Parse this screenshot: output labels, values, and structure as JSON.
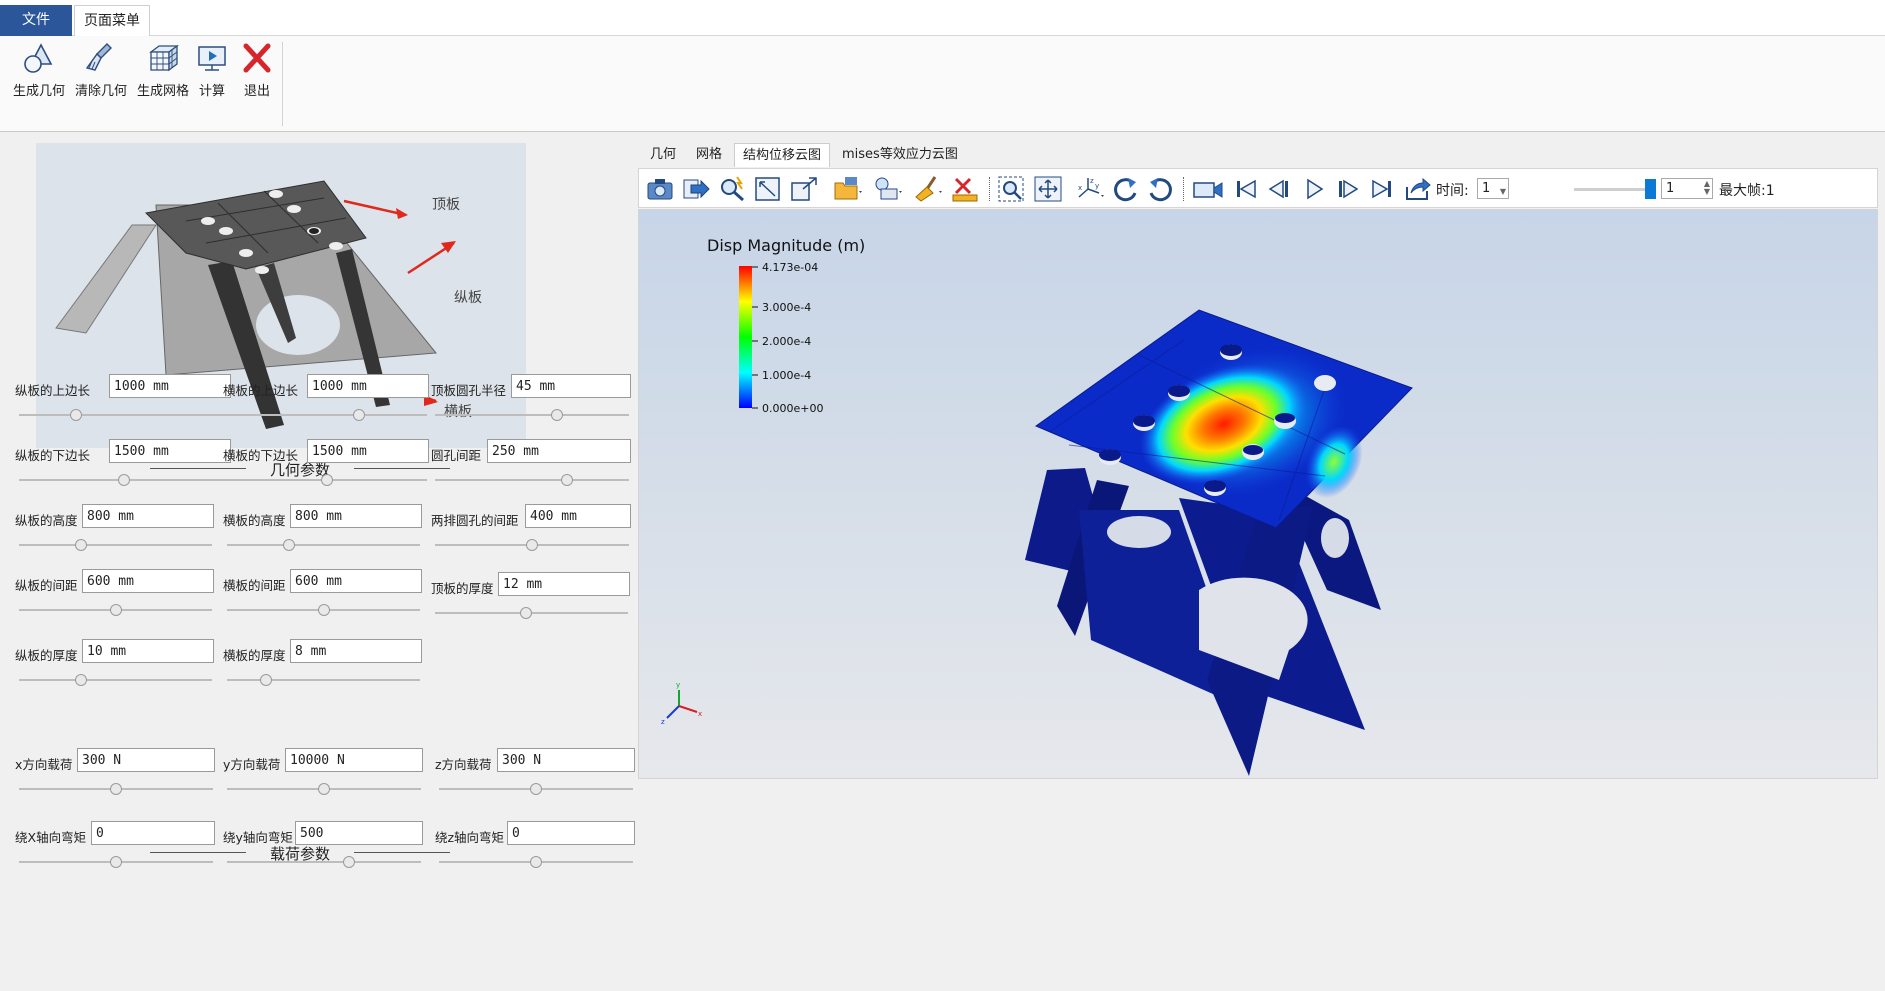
{
  "menu": {
    "file": "文件",
    "page_menu": "页面菜单"
  },
  "ribbon": [
    {
      "label": "生成几何",
      "icon": "geometry-icon"
    },
    {
      "label": "清除几何",
      "icon": "brush-icon"
    },
    {
      "label": "生成网格",
      "icon": "mesh-icon"
    },
    {
      "label": "计算",
      "icon": "compute-icon"
    },
    {
      "label": "退出",
      "icon": "exit-icon"
    }
  ],
  "diagram": {
    "label_top": "顶板",
    "label_long": "纵板",
    "label_cross": "横板"
  },
  "geometry_section": {
    "title": "几何参数",
    "fields": [
      {
        "label": "纵板的上边长",
        "value": "1000 mm",
        "slider": 0.27
      },
      {
        "label": "横板的上边长",
        "value": "1000 mm",
        "slider": 0.66
      },
      {
        "label": "顶板圆孔半径",
        "value": "45 mm",
        "slider": 0.63
      },
      {
        "label": "纵板的下边长",
        "value": "1500 mm",
        "slider": 0.5
      },
      {
        "label": "横板的下边长",
        "value": "1500 mm",
        "slider": 0.5
      },
      {
        "label": "圆孔间距",
        "value": "250 mm",
        "slider": 0.68
      },
      {
        "label": "纵板的高度",
        "value": "800 mm",
        "slider": 0.32
      },
      {
        "label": "横板的高度",
        "value": "800 mm",
        "slider": 0.32
      },
      {
        "label": "两排圆孔的间距",
        "value": "400 mm",
        "slider": 0.5
      },
      {
        "label": "纵板的间距",
        "value": "600 mm",
        "slider": 0.5
      },
      {
        "label": "横板的间距",
        "value": "600 mm",
        "slider": 0.5
      },
      {
        "label": "顶板的厚度",
        "value": "12 mm",
        "slider": 0.47
      },
      {
        "label": "纵板的厚度",
        "value": "10 mm",
        "slider": 0.32
      },
      {
        "label": "横板的厚度",
        "value": "8 mm",
        "slider": 0.2
      }
    ]
  },
  "load_section": {
    "title": "载荷参数",
    "fields": [
      {
        "label": "x方向载荷",
        "value": "300 N",
        "slider": 0.5
      },
      {
        "label": "y方向载荷",
        "value": "10000 N",
        "slider": 0.5
      },
      {
        "label": "z方向载荷",
        "value": "300 N",
        "slider": 0.5
      },
      {
        "label": "绕X轴向弯矩",
        "value": "0",
        "slider": 0.5
      },
      {
        "label": "绕y轴向弯矩",
        "value": "500",
        "slider": 0.63
      },
      {
        "label": "绕z轴向弯矩",
        "value": "0",
        "slider": 0.5
      }
    ]
  },
  "viewer": {
    "tabs": [
      "几何",
      "网格",
      "结构位移云图",
      "mises等效应力云图"
    ],
    "active_tab": 2,
    "time_label": "时间:",
    "time_value": "1",
    "frame_value": "1",
    "max_frame": "最大帧:1",
    "time_slider": 1.0
  },
  "colorbar": {
    "title": "Disp Magnitude (m)",
    "ticks": [
      "4.173e-04",
      "3.000e-4",
      "2.000e-4",
      "1.000e-4",
      "0.000e+00"
    ]
  },
  "axes": {
    "x": "x",
    "y": "y",
    "z": "z"
  },
  "colors": {
    "accent": "#2b579a",
    "plate_blue": "#0c1d8c",
    "hot": "#ff2a00"
  }
}
